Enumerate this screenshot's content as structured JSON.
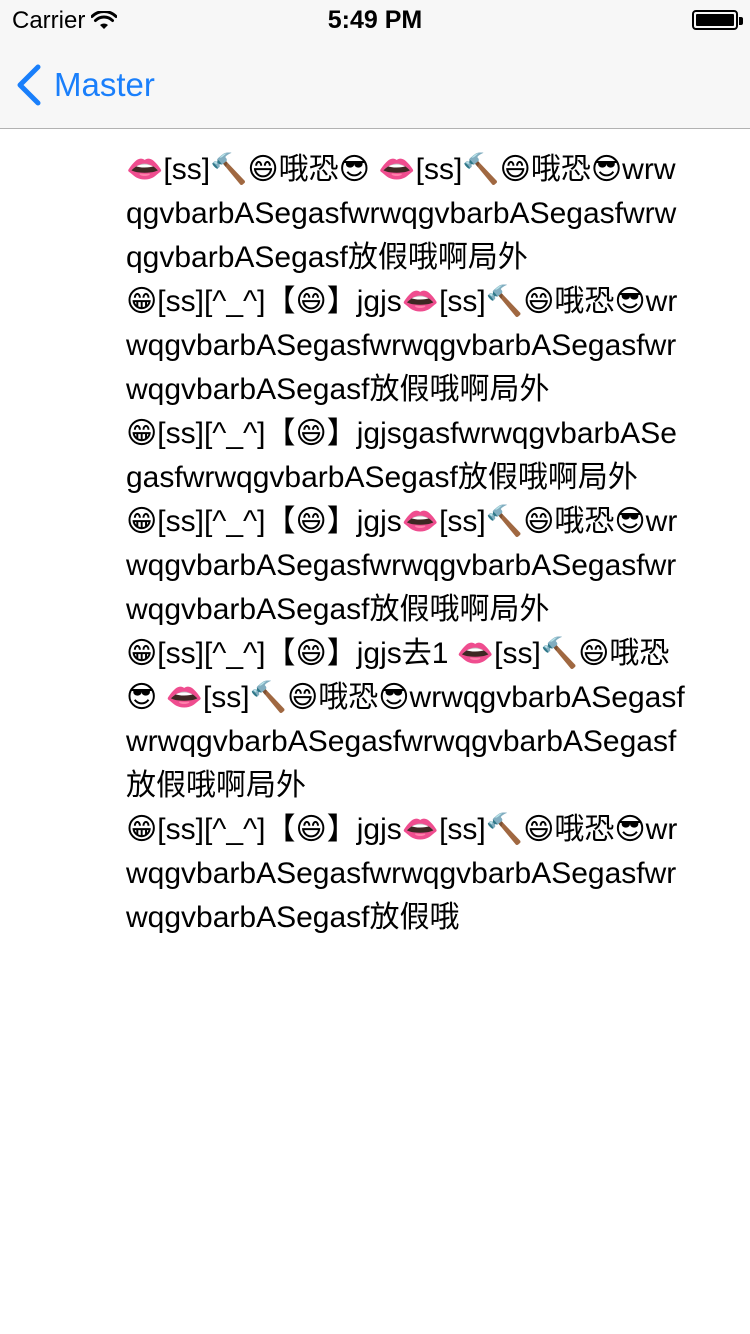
{
  "status_bar": {
    "carrier": "Carrier",
    "time": "5:49 PM"
  },
  "nav": {
    "back_label": "Master"
  },
  "messages": [
    "👄[ss]🔨😄哦恐😎 👄[ss]🔨😄哦恐😎wrwqgvbarbASegasfwrwqgvbarbASegasfwrwqgvbarbASegasf放假哦啊局外",
    "😁[ss][^_^]【😄】jgjs👄[ss]🔨😄哦恐😎wrwqgvbarbASegasfwrwqgvbarbASegasfwrwqgvbarbASegasf放假哦啊局外",
    "😁[ss][^_^]【😄】jgjsgasfwrwqgvbarbASegasfwrwqgvbarbASegasf放假哦啊局外",
    "😁[ss][^_^]【😄】jgjs👄[ss]🔨😄哦恐😎wrwqgvbarbASegasfwrwqgvbarbASegasfwrwqgvbarbASegasf放假哦啊局外",
    "😁[ss][^_^]【😄】jgjs去1 👄[ss]🔨😄哦恐😎 👄[ss]🔨😄哦恐😎wrwqgvbarbASegasfwrwqgvbarbASegasfwrwqgvbarbASegasf放假哦啊局外",
    "😁[ss][^_^]【😄】jgjs👄[ss]🔨😄哦恐😎wrwqgvbarbASegasfwrwqgvbarbASegasfwrwqgvbarbASegasf放假哦"
  ]
}
